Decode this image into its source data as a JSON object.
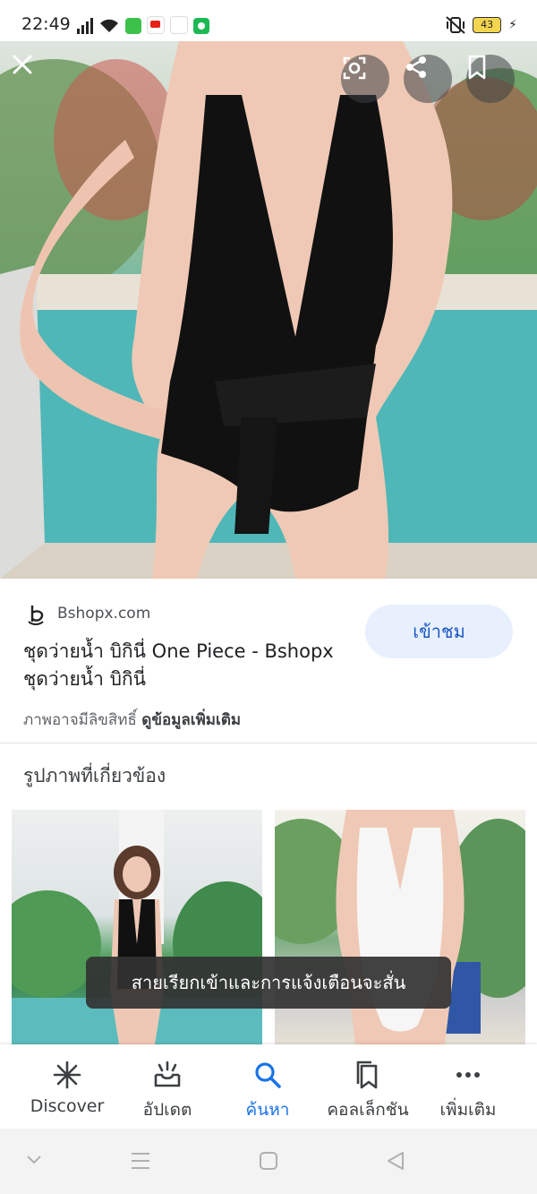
{
  "status_bar": {
    "time": "22:49",
    "battery": "43"
  },
  "hero": {
    "close_icon": "close-icon",
    "lens_icon": "lens-icon",
    "share_icon": "share-icon",
    "bookmark_icon": "bookmark-icon"
  },
  "result": {
    "source": "Bshopx.com",
    "title": "ชุดว่ายน้ำ บิกินี่ One Piece - Bshopx ชุดว่ายน้ำ บิกินี่",
    "visit_label": "เข้าชม",
    "copyright_text": "ภาพอาจมีลิขสิทธิ์",
    "more_info_link": "ดูข้อมูลเพิ่มเติม"
  },
  "related": {
    "heading": "รูปภาพที่เกี่ยวข้อง"
  },
  "toast": {
    "text": "สายเรียกเข้าและการแจ้งเตือนจะสั่น"
  },
  "bottom_nav": {
    "items": [
      {
        "label": "Discover",
        "icon": "asterisk-icon"
      },
      {
        "label": "อัปเดต",
        "icon": "updates-icon"
      },
      {
        "label": "ค้นหา",
        "icon": "search-icon"
      },
      {
        "label": "คอลเล็กชัน",
        "icon": "collections-icon"
      },
      {
        "label": "เพิ่มเติม",
        "icon": "more-icon"
      }
    ],
    "active_index": 2
  },
  "colors": {
    "accent": "#1a73e8",
    "visit_bg": "#e8f0fe"
  }
}
